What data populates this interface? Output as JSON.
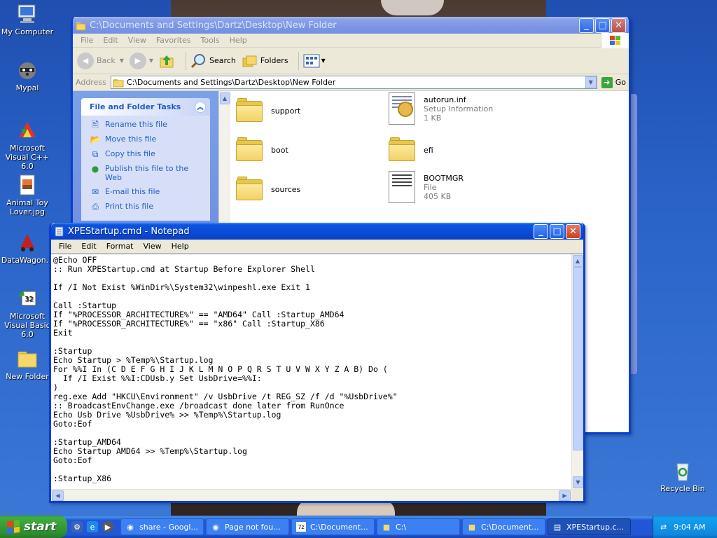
{
  "desktop": {
    "icons": [
      {
        "label": "My Computer"
      },
      {
        "label": "Mypal"
      },
      {
        "label": "Microsoft Visual C++ 6.0"
      },
      {
        "label": "Animal Toy Lover.jpg"
      },
      {
        "label": "DataWagon..."
      },
      {
        "label": "Microsoft Visual Basic 6.0"
      },
      {
        "label": "New Folder"
      },
      {
        "label": "Recycle Bin"
      }
    ]
  },
  "explorer": {
    "title": "C:\\Documents and Settings\\Dartz\\Desktop\\New Folder",
    "menu": [
      "File",
      "Edit",
      "View",
      "Favorites",
      "Tools",
      "Help"
    ],
    "toolbar": {
      "back": "Back",
      "search": "Search",
      "folders": "Folders"
    },
    "address": {
      "label": "Address",
      "value": "C:\\Documents and Settings\\Dartz\\Desktop\\New Folder",
      "go": "Go"
    },
    "tasks": {
      "title": "File and Folder Tasks",
      "items": [
        {
          "label": "Rename this file"
        },
        {
          "label": "Move this file"
        },
        {
          "label": "Copy this file"
        },
        {
          "label": "Publish this file to the Web"
        },
        {
          "label": "E-mail this file"
        },
        {
          "label": "Print this file"
        }
      ]
    },
    "files": [
      {
        "name": "support"
      },
      {
        "name": "autorun.inf",
        "type": "Setup Information",
        "size": "1 KB"
      },
      {
        "name": "boot"
      },
      {
        "name": "efi"
      },
      {
        "name": "sources"
      },
      {
        "name": "BOOTMGR",
        "type": "File",
        "size": "405 KB"
      }
    ]
  },
  "notepad": {
    "title": "XPEStartup.cmd - Notepad",
    "menu": [
      "File",
      "Edit",
      "Format",
      "View",
      "Help"
    ],
    "content": "@Echo OFF\n:: Run XPEStartup.cmd at Startup Before Explorer Shell\n\nIf /I Not Exist %WinDir%\\System32\\winpeshl.exe Exit 1\n\nCall :Startup\nIf \"%PROCESSOR_ARCHITECTURE%\" == \"AMD64\" Call :Startup_AMD64\nIf \"%PROCESSOR_ARCHITECTURE%\" == \"x86\" Call :Startup_X86\nExit\n\n:Startup\nEcho Startup > %Temp%\\Startup.log\nFor %%I In (C D E F G H I J K L M N O P Q R S T U V W X Y Z A B) Do (\n  If /I Exist %%I:CDUsb.y Set UsbDrive=%%I:\n)\nreg.exe Add \"HKCU\\Environment\" /v UsbDrive /t REG_SZ /f /d \"%UsbDrive%\"\n:: BroadcastEnvChange.exe /broadcast done later from RunOnce\nEcho Usb Drive %UsbDrive% >> %Temp%\\Startup.log\nGoto:Eof\n\n:Startup_AMD64\nEcho Startup AMD64 >> %Temp%\\Startup.log\nGoto:Eof\n\n:Startup_X86"
  },
  "taskbar": {
    "start": "start",
    "tasks": [
      {
        "label": "share - Googl...",
        "active": false
      },
      {
        "label": "Page not fou...",
        "active": false
      },
      {
        "label": "C:\\Document...",
        "active": false
      },
      {
        "label": "C:\\",
        "active": false
      },
      {
        "label": "C:\\Document...",
        "active": false
      },
      {
        "label": "XPEStartup.c...",
        "active": true
      }
    ],
    "clock": "9:04 AM"
  }
}
